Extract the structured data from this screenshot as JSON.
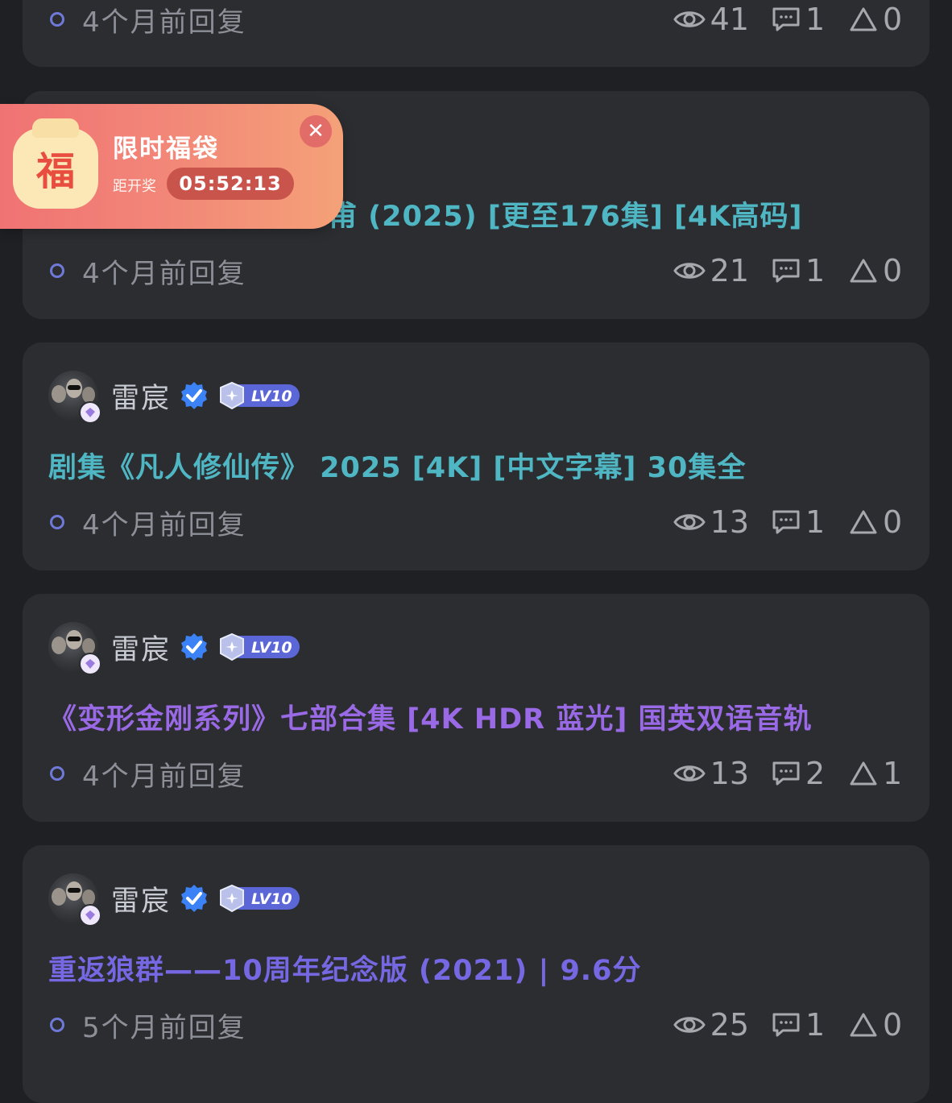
{
  "posts": [
    {
      "id": "p0",
      "author": "",
      "title": "",
      "reply_time": "4个月前回复",
      "views": "41",
      "comments": "1",
      "likes": "0"
    },
    {
      "id": "p1",
      "author": "",
      "title_visible": "甫 (2025) [更至176集] [4K高码]",
      "reply_time": "4个月前回复",
      "views": "21",
      "comments": "1",
      "likes": "0"
    },
    {
      "id": "p2",
      "author": "雷宸",
      "level": "LV10",
      "title": "剧集《凡人修仙传》 2025 [4K] [中文字幕] 30集全",
      "reply_time": "4个月前回复",
      "views": "13",
      "comments": "1",
      "likes": "0"
    },
    {
      "id": "p3",
      "author": "雷宸",
      "level": "LV10",
      "title": "《变形金刚系列》七部合集 [4K HDR 蓝光] 国英双语音轨",
      "reply_time": "4个月前回复",
      "views": "13",
      "comments": "2",
      "likes": "1"
    },
    {
      "id": "p4",
      "author": "雷宸",
      "level": "LV10",
      "title": "重返狼群——10周年纪念版 (2021) | 9.6分",
      "reply_time": "5个月前回复",
      "views": "25",
      "comments": "1",
      "likes": "0"
    }
  ],
  "promo": {
    "bag_char": "福",
    "title": "限时福袋",
    "countdown_label": "距开奖",
    "timer": "05:52:13",
    "close_symbol": "✕"
  },
  "icons": {
    "views": "eye-icon",
    "comments": "comment-icon",
    "likes": "triangle-like-icon"
  },
  "colors": {
    "background": "#1f2024",
    "card": "#2c2d31",
    "title_teal": "#4fb6c3",
    "title_purple": "#9a6ae6",
    "title_indigo": "#7568e2",
    "verified_blue": "#3b82f6",
    "promo_start": "#f07373",
    "promo_end": "#f4a178"
  }
}
